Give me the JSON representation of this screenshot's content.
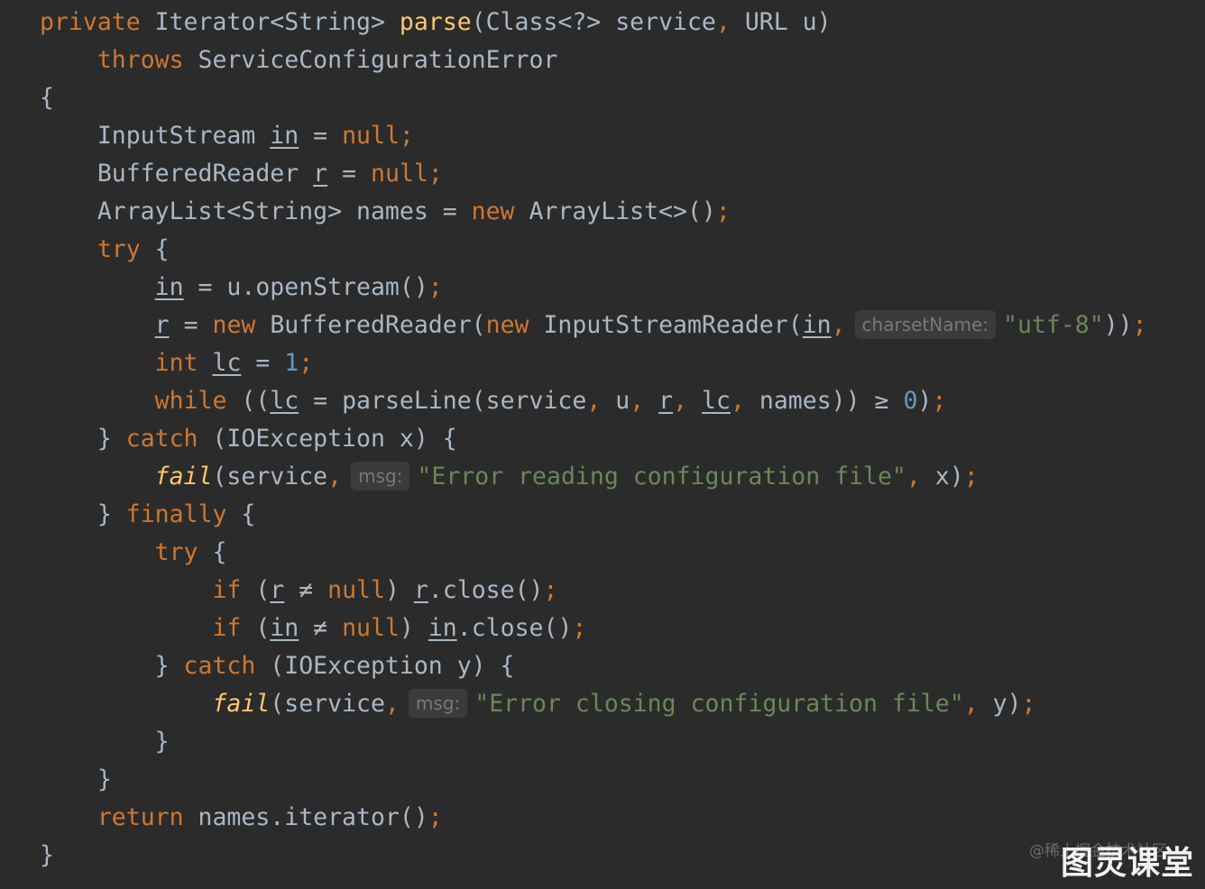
{
  "editor": {
    "background": "#2b2b2b",
    "colors": {
      "keyword": "#cc7832",
      "identifier": "#a9b7c6",
      "method_declaration": "#ffc66d",
      "string": "#6a8759",
      "number": "#6897bb",
      "inlay_hint": "#787878"
    },
    "lines": [
      [
        {
          "t": "private",
          "c": "kw"
        },
        {
          "t": " Iterator<String> ",
          "c": "id"
        },
        {
          "t": "parse",
          "c": "fn"
        },
        {
          "t": "(Class<?> service",
          "c": "id"
        },
        {
          "t": ",",
          "c": "punc"
        },
        {
          "t": " URL u)",
          "c": "id"
        }
      ],
      [
        {
          "t": "    ",
          "c": "id"
        },
        {
          "t": "throws",
          "c": "kw"
        },
        {
          "t": " ServiceConfigurationError",
          "c": "id"
        }
      ],
      [
        {
          "t": "{",
          "c": "id"
        }
      ],
      [
        {
          "t": "    InputStream ",
          "c": "id"
        },
        {
          "t": "in",
          "c": "ul"
        },
        {
          "t": " = ",
          "c": "id"
        },
        {
          "t": "null",
          "c": "kw"
        },
        {
          "t": ";",
          "c": "punc"
        }
      ],
      [
        {
          "t": "    BufferedReader ",
          "c": "id"
        },
        {
          "t": "r",
          "c": "ul"
        },
        {
          "t": " = ",
          "c": "id"
        },
        {
          "t": "null",
          "c": "kw"
        },
        {
          "t": ";",
          "c": "punc"
        }
      ],
      [
        {
          "t": "    ArrayList<String> names = ",
          "c": "id"
        },
        {
          "t": "new",
          "c": "kw"
        },
        {
          "t": " ArrayList<>()",
          "c": "id"
        },
        {
          "t": ";",
          "c": "punc"
        }
      ],
      [
        {
          "t": "    ",
          "c": "id"
        },
        {
          "t": "try",
          "c": "kw"
        },
        {
          "t": " {",
          "c": "id"
        }
      ],
      [
        {
          "t": "        ",
          "c": "id"
        },
        {
          "t": "in",
          "c": "ul"
        },
        {
          "t": " = u.openStream()",
          "c": "id"
        },
        {
          "t": ";",
          "c": "punc"
        }
      ],
      [
        {
          "t": "        ",
          "c": "id"
        },
        {
          "t": "r",
          "c": "ul"
        },
        {
          "t": " = ",
          "c": "id"
        },
        {
          "t": "new",
          "c": "kw"
        },
        {
          "t": " BufferedReader(",
          "c": "id"
        },
        {
          "t": "new",
          "c": "kw"
        },
        {
          "t": " InputStreamReader(",
          "c": "id"
        },
        {
          "t": "in",
          "c": "ul"
        },
        {
          "t": ",",
          "c": "punc"
        },
        {
          "t": "charsetName:",
          "c": "hint"
        },
        {
          "t": "\"utf-8\"",
          "c": "str"
        },
        {
          "t": "))",
          "c": "id"
        },
        {
          "t": ";",
          "c": "punc"
        }
      ],
      [
        {
          "t": "        ",
          "c": "id"
        },
        {
          "t": "int",
          "c": "kw"
        },
        {
          "t": " ",
          "c": "id"
        },
        {
          "t": "lc",
          "c": "ul"
        },
        {
          "t": " = ",
          "c": "id"
        },
        {
          "t": "1",
          "c": "num"
        },
        {
          "t": ";",
          "c": "punc"
        }
      ],
      [
        {
          "t": "        ",
          "c": "id"
        },
        {
          "t": "while",
          "c": "kw"
        },
        {
          "t": " ((",
          "c": "id"
        },
        {
          "t": "lc",
          "c": "ul"
        },
        {
          "t": " = parseLine(service",
          "c": "id"
        },
        {
          "t": ",",
          "c": "punc"
        },
        {
          "t": " u",
          "c": "id"
        },
        {
          "t": ",",
          "c": "punc"
        },
        {
          "t": " ",
          "c": "id"
        },
        {
          "t": "r",
          "c": "ul"
        },
        {
          "t": ",",
          "c": "punc"
        },
        {
          "t": " ",
          "c": "id"
        },
        {
          "t": "lc",
          "c": "ul"
        },
        {
          "t": ",",
          "c": "punc"
        },
        {
          "t": " names)) ≥ ",
          "c": "id"
        },
        {
          "t": "0",
          "c": "num"
        },
        {
          "t": ")",
          "c": "id"
        },
        {
          "t": ";",
          "c": "punc"
        }
      ],
      [
        {
          "t": "    } ",
          "c": "id"
        },
        {
          "t": "catch",
          "c": "kw"
        },
        {
          "t": " (IOException x) {",
          "c": "id"
        }
      ],
      [
        {
          "t": "        ",
          "c": "id"
        },
        {
          "t": "fail",
          "c": "it"
        },
        {
          "t": "(service",
          "c": "id"
        },
        {
          "t": ",",
          "c": "punc"
        },
        {
          "t": "msg:",
          "c": "hint"
        },
        {
          "t": "\"Error reading configuration file\"",
          "c": "str"
        },
        {
          "t": ",",
          "c": "punc"
        },
        {
          "t": " x)",
          "c": "id"
        },
        {
          "t": ";",
          "c": "punc"
        }
      ],
      [
        {
          "t": "    } ",
          "c": "id"
        },
        {
          "t": "finally",
          "c": "kw"
        },
        {
          "t": " {",
          "c": "id"
        }
      ],
      [
        {
          "t": "        ",
          "c": "id"
        },
        {
          "t": "try",
          "c": "kw"
        },
        {
          "t": " {",
          "c": "id"
        }
      ],
      [
        {
          "t": "            ",
          "c": "id"
        },
        {
          "t": "if",
          "c": "kw"
        },
        {
          "t": " (",
          "c": "id"
        },
        {
          "t": "r",
          "c": "ul"
        },
        {
          "t": " ≠ ",
          "c": "id"
        },
        {
          "t": "null",
          "c": "kw"
        },
        {
          "t": ") ",
          "c": "id"
        },
        {
          "t": "r",
          "c": "ul"
        },
        {
          "t": ".close()",
          "c": "id"
        },
        {
          "t": ";",
          "c": "punc"
        }
      ],
      [
        {
          "t": "            ",
          "c": "id"
        },
        {
          "t": "if",
          "c": "kw"
        },
        {
          "t": " (",
          "c": "id"
        },
        {
          "t": "in",
          "c": "ul"
        },
        {
          "t": " ≠ ",
          "c": "id"
        },
        {
          "t": "null",
          "c": "kw"
        },
        {
          "t": ") ",
          "c": "id"
        },
        {
          "t": "in",
          "c": "ul"
        },
        {
          "t": ".close()",
          "c": "id"
        },
        {
          "t": ";",
          "c": "punc"
        }
      ],
      [
        {
          "t": "        } ",
          "c": "id"
        },
        {
          "t": "catch",
          "c": "kw"
        },
        {
          "t": " (IOException y) {",
          "c": "id"
        }
      ],
      [
        {
          "t": "            ",
          "c": "id"
        },
        {
          "t": "fail",
          "c": "it"
        },
        {
          "t": "(service",
          "c": "id"
        },
        {
          "t": ",",
          "c": "punc"
        },
        {
          "t": "msg:",
          "c": "hint"
        },
        {
          "t": "\"Error closing configuration file\"",
          "c": "str"
        },
        {
          "t": ",",
          "c": "punc"
        },
        {
          "t": " y)",
          "c": "id"
        },
        {
          "t": ";",
          "c": "punc"
        }
      ],
      [
        {
          "t": "        }",
          "c": "id"
        }
      ],
      [
        {
          "t": "    }",
          "c": "id"
        }
      ],
      [
        {
          "t": "    ",
          "c": "id"
        },
        {
          "t": "return",
          "c": "kw"
        },
        {
          "t": " names.iterator()",
          "c": "id"
        },
        {
          "t": ";",
          "c": "punc"
        }
      ],
      [
        {
          "t": "}",
          "c": "id"
        }
      ]
    ]
  },
  "watermark": {
    "site": "@稀土掘金技术社区",
    "brand": "图灵课堂"
  }
}
